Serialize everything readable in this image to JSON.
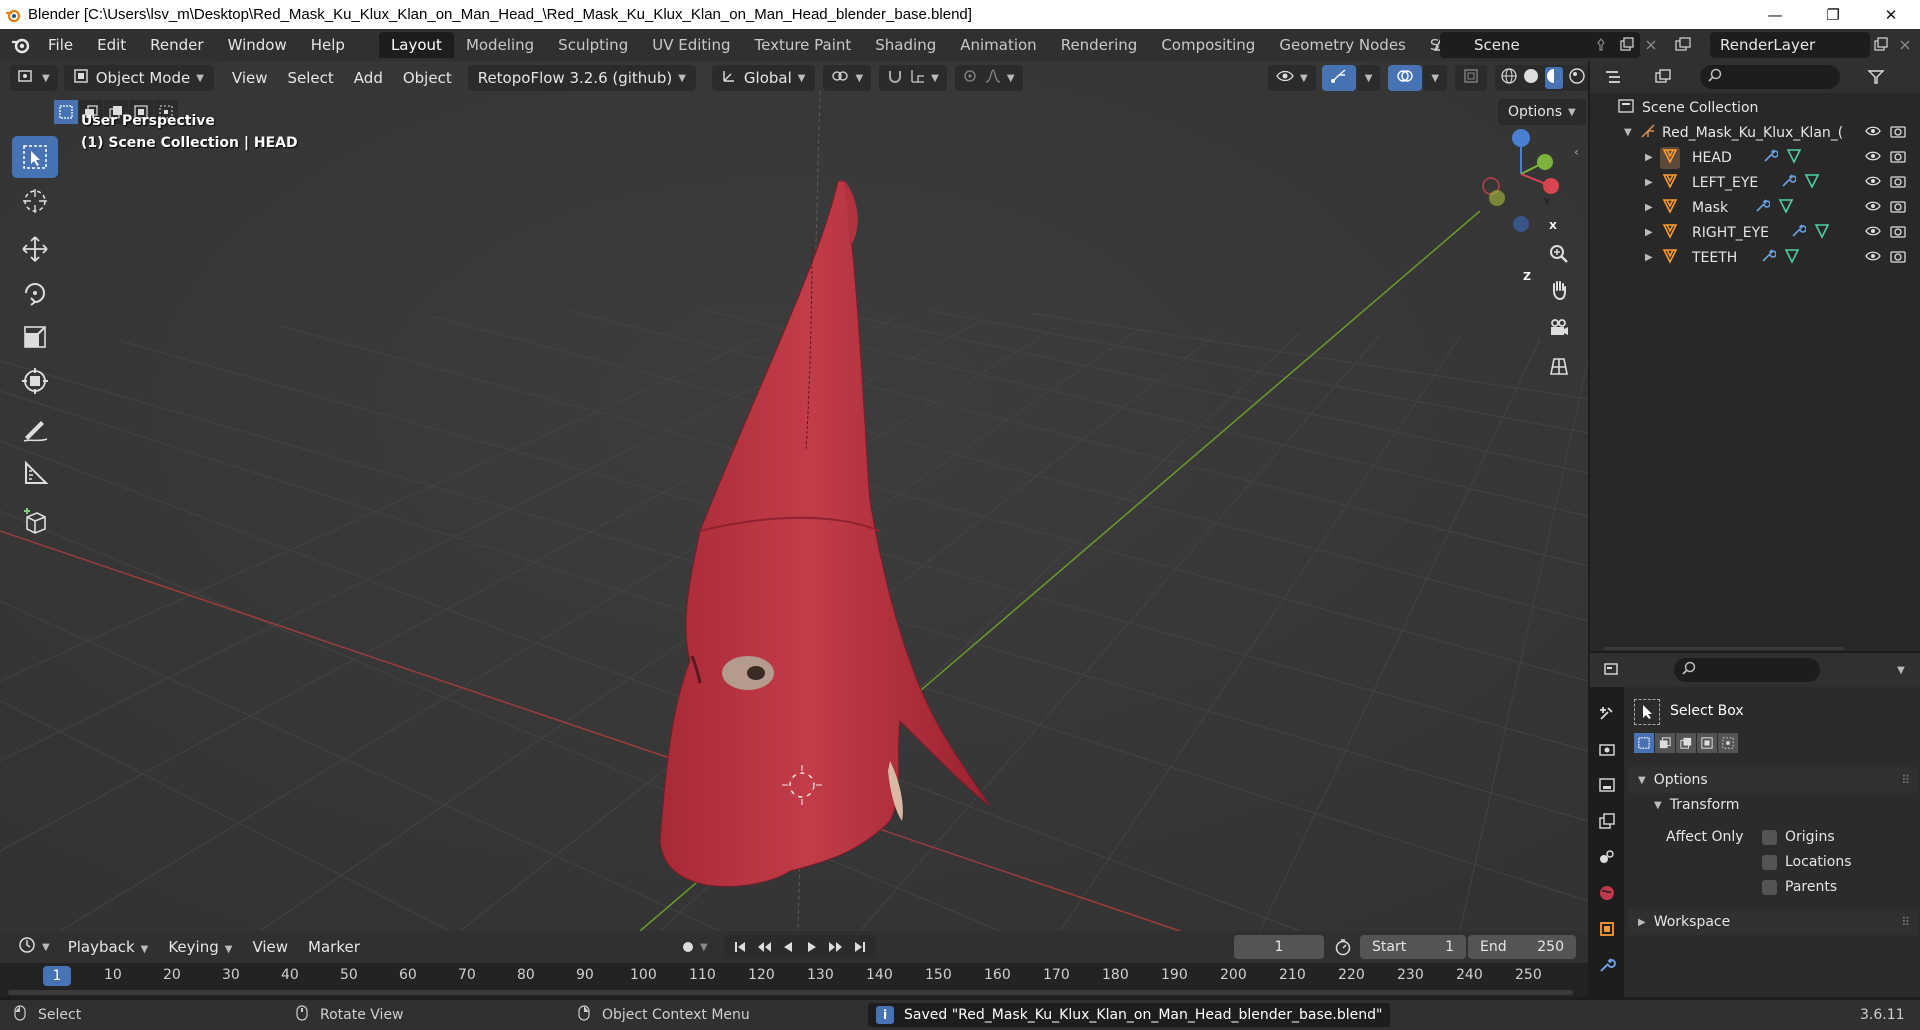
{
  "window": {
    "title": "Blender [C:\\Users\\lsv_m\\Desktop\\Red_Mask_Ku_Klux_Klan_on_Man_Head_\\Red_Mask_Ku_Klux_Klan_on_Man_Head_blender_base.blend]",
    "minimize": "—",
    "restore": "❐",
    "close": "✕"
  },
  "menu": {
    "items": [
      "File",
      "Edit",
      "Render",
      "Window",
      "Help"
    ]
  },
  "workspaces": {
    "tabs": [
      "Layout",
      "Modeling",
      "Sculpting",
      "UV Editing",
      "Texture Paint",
      "Shading",
      "Animation",
      "Rendering",
      "Compositing",
      "Geometry Nodes",
      "Scripting"
    ],
    "active": "Layout",
    "add": "+"
  },
  "scene": {
    "name": "Scene"
  },
  "render_layer": {
    "name": "RenderLayer"
  },
  "viewport": {
    "mode": "Object Mode",
    "menus": [
      "View",
      "Select",
      "Add",
      "Object"
    ],
    "addon": "RetopoFlow 3.2.6 (github)",
    "orientation": "Global",
    "overlay_line1": "User Perspective",
    "overlay_line2": "(1) Scene Collection | HEAD",
    "options": "Options",
    "gizmo": {
      "z": "Z",
      "y": "Y",
      "x": "X"
    },
    "colors": {
      "bg": "#393939",
      "mask": "#b8323f",
      "x_axis": "#a83a3a",
      "y_axis": "#6f9a2c"
    }
  },
  "outliner": {
    "root": "Scene Collection",
    "collection": "Red_Mask_Ku_Klux_Klan_on_Man_Head",
    "collection_display": "Red_Mask_Ku_Klux_Klan_(",
    "objects": [
      {
        "name": "HEAD"
      },
      {
        "name": "LEFT_EYE"
      },
      {
        "name": "Mask"
      },
      {
        "name": "RIGHT_EYE"
      },
      {
        "name": "TEETH"
      }
    ]
  },
  "properties": {
    "tool_name": "Select Box",
    "options_panel": "Options",
    "transform_panel": "Transform",
    "affect_only": "Affect Only",
    "checkboxes": [
      "Origins",
      "Locations",
      "Parents"
    ],
    "workspace_panel": "Workspace"
  },
  "timeline": {
    "menus": [
      "Playback",
      "Keying",
      "View",
      "Marker"
    ],
    "current_frame": "1",
    "start_label": "Start",
    "start": "1",
    "end_label": "End",
    "end": "250",
    "ruler": [
      "1",
      "10",
      "20",
      "30",
      "40",
      "50",
      "60",
      "70",
      "80",
      "90",
      "100",
      "110",
      "120",
      "130",
      "140",
      "150",
      "160",
      "170",
      "180",
      "190",
      "200",
      "210",
      "220",
      "230",
      "240",
      "250"
    ]
  },
  "status": {
    "select": "Select",
    "rotate": "Rotate View",
    "context": "Object Context Menu",
    "saved": "Saved \"Red_Mask_Ku_Klux_Klan_on_Man_Head_blender_base.blend\"",
    "version": "3.6.11"
  }
}
